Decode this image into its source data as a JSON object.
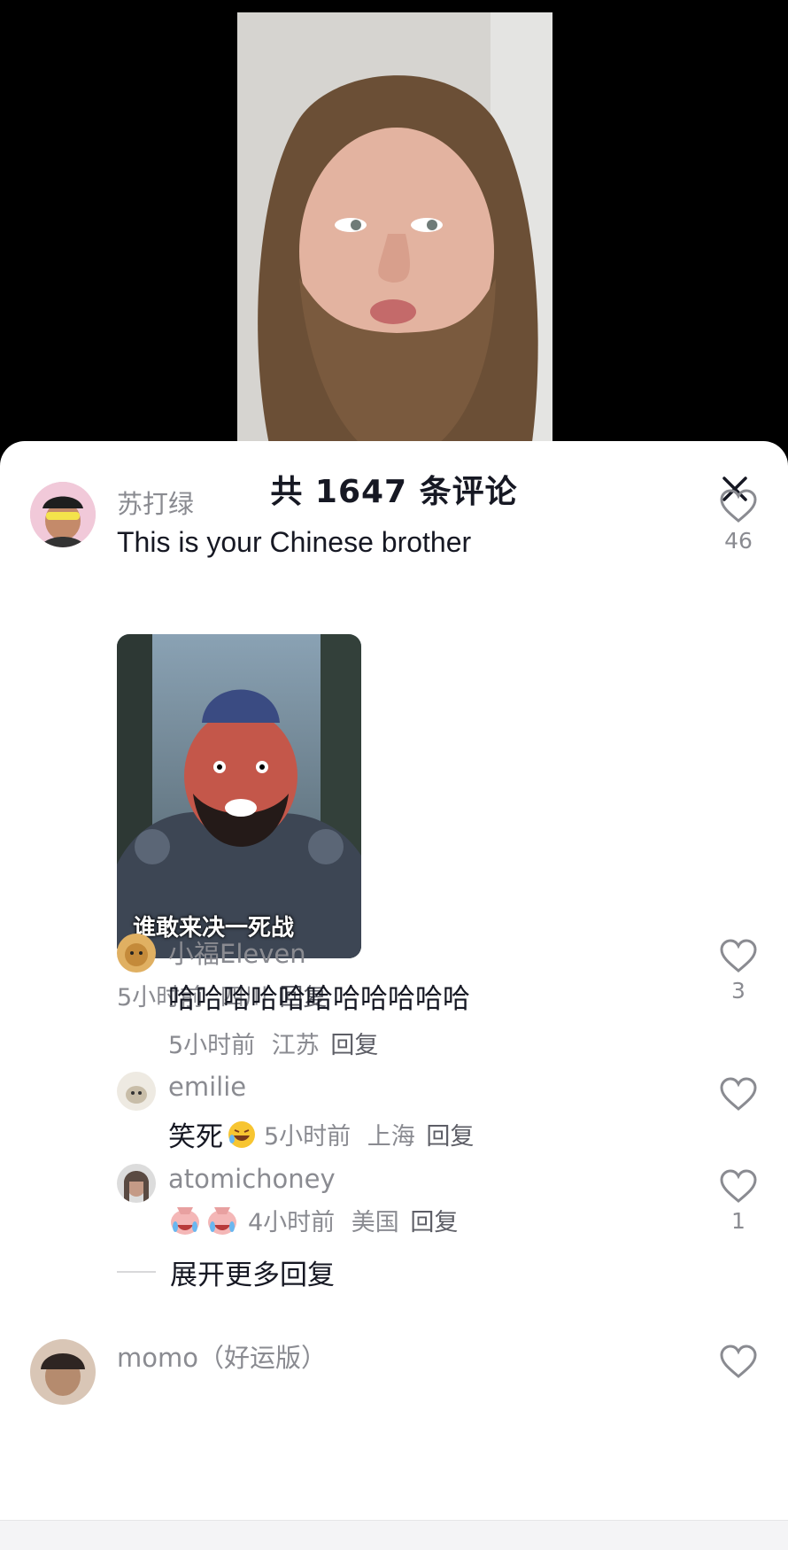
{
  "header": {
    "title": "共 1647 条评论"
  },
  "comments": [
    {
      "user": "苏打绿",
      "text": "This is your Chinese brother",
      "likes": "46",
      "image_caption": "谁敢来决一死战",
      "image_watermark": "",
      "time": "5小时前",
      "location": "四川",
      "reply_label": "回复"
    }
  ],
  "replies": [
    {
      "user": "小福Eleven",
      "text": "哈哈哈哈哈哈哈哈哈哈哈",
      "likes": "3",
      "time": "5小时前",
      "location": "江苏",
      "reply_label": "回复"
    },
    {
      "user": "emilie",
      "text": "笑死",
      "emoji": "rolling-laughing-icon",
      "likes": "",
      "time": "5小时前",
      "location": "上海",
      "reply_label": "回复"
    },
    {
      "user": "atomichoney",
      "emoji": "crying-laughing-face-icon x2",
      "likes": "1",
      "time": "4小时前",
      "location": "美国",
      "reply_label": "回复"
    }
  ],
  "expand_label": "展开更多回复",
  "next_comment": {
    "user": "momo（好运版）"
  },
  "colors": {
    "text_primary": "#161823",
    "text_secondary": "#8a8b91",
    "background": "#ffffff"
  }
}
